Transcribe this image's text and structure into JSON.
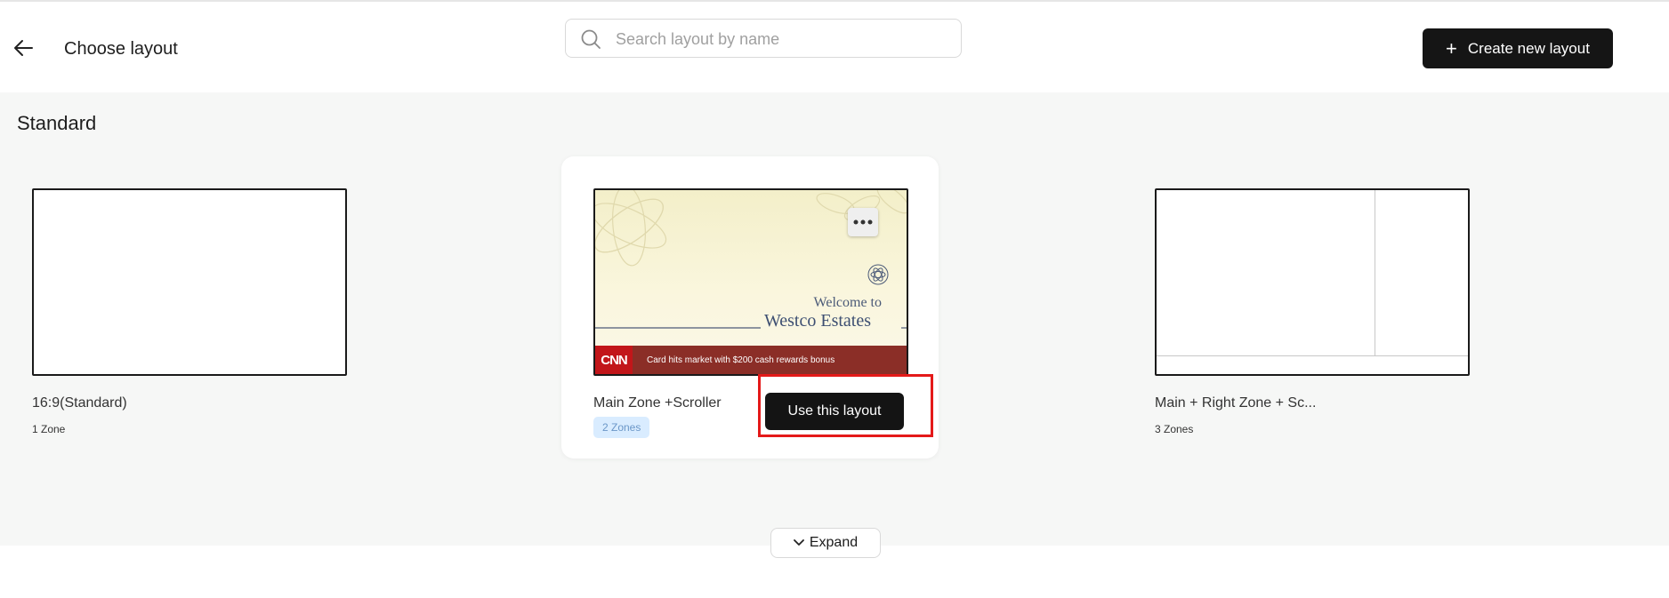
{
  "header": {
    "title": "Choose layout",
    "search_placeholder": "Search layout by name",
    "create_label": "Create new layout"
  },
  "section": {
    "title": "Standard"
  },
  "layouts": [
    {
      "name": "16:9(Standard)",
      "zones": "1 Zone"
    },
    {
      "name": "Main Zone +Scroller",
      "zones": "2 Zones",
      "action_label": "Use this layout",
      "preview": {
        "welcome": "Welcome to",
        "estate": "Westco Estates",
        "ticker_logo": "CNN",
        "ticker_text": "Card hits market with $200 cash rewards bonus"
      }
    },
    {
      "name": "Main + Right Zone + Sc...",
      "zones": "3 Zones"
    }
  ],
  "footer": {
    "expand_label": "Expand"
  },
  "icons": {
    "back": "arrow-left-icon",
    "search": "search-icon",
    "plus": "plus-icon",
    "more": "more-dots-icon",
    "chevron": "chevron-down-icon"
  },
  "colors": {
    "primary_button": "#151515",
    "zone_pill_bg": "#d9ecff",
    "highlight": "#e41919",
    "ticker": "#8b2e27"
  }
}
